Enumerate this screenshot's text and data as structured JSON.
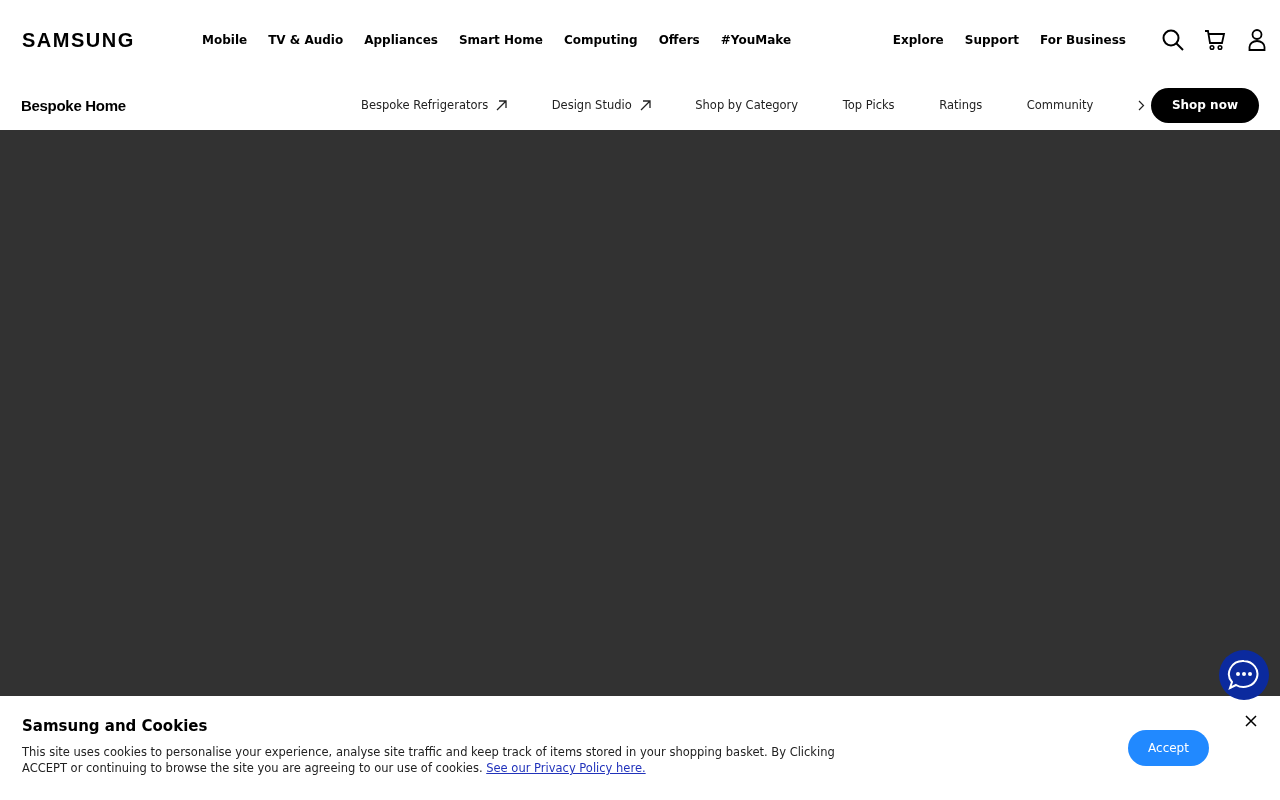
{
  "logo": "SAMSUNG",
  "main_nav": [
    "Mobile",
    "TV & Audio",
    "Appliances",
    "Smart Home",
    "Computing",
    "Offers",
    "#YouMake"
  ],
  "utility_nav": [
    "Explore",
    "Support",
    "For Business"
  ],
  "sub_nav": {
    "title": "Bespoke Home",
    "items": [
      {
        "label": "Bespoke Refrigerators",
        "kind": "external"
      },
      {
        "label": "Design Studio",
        "kind": "external"
      },
      {
        "label": "Shop by Category",
        "kind": "plain"
      },
      {
        "label": "Top Picks",
        "kind": "plain"
      },
      {
        "label": "Ratings",
        "kind": "plain"
      },
      {
        "label": "Community",
        "kind": "plain"
      }
    ],
    "cta": "Shop now"
  },
  "cookie_banner": {
    "title": "Samsung and Cookies",
    "text": "This site uses cookies to personalise your experience, analyse site traffic and keep track of items stored in your shopping basket. By Clicking ACCEPT or continuing to browse the site you are agreeing to our use of cookies.",
    "link": "See our Privacy Policy here.",
    "button": "Accept"
  }
}
